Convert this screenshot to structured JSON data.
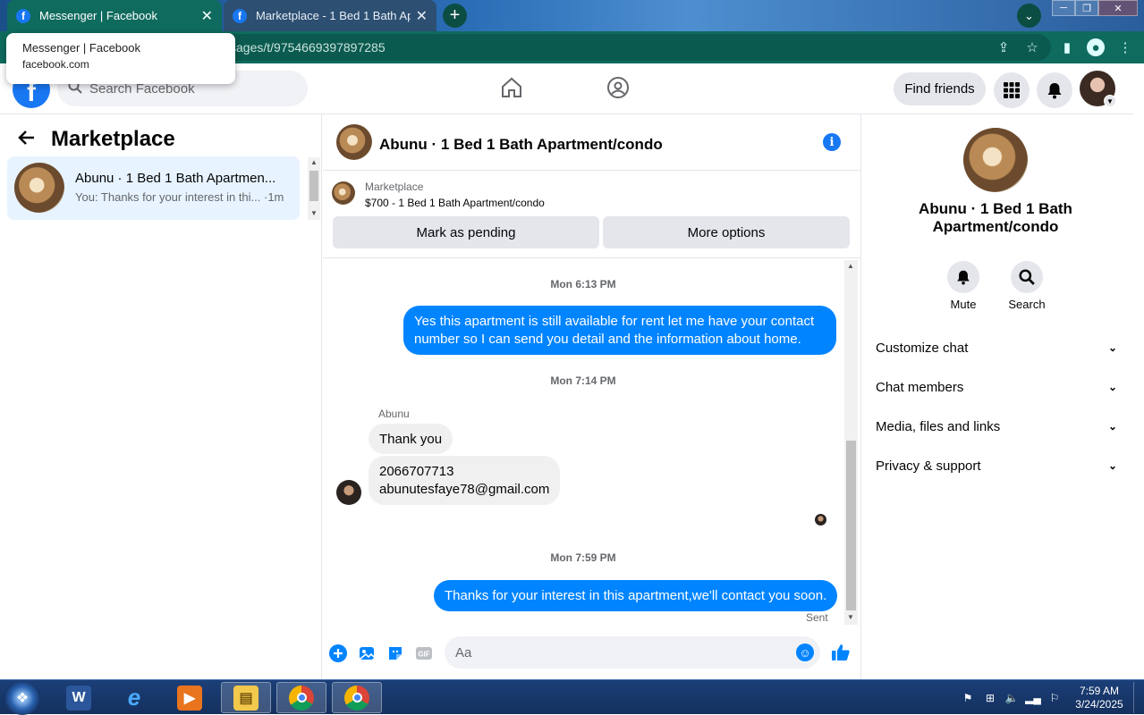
{
  "browser": {
    "tabs": [
      {
        "title": "Messenger | Facebook",
        "active": true
      },
      {
        "title": "Marketplace - 1 Bed 1 Bath Apartment/condo",
        "active": false
      }
    ],
    "url": "sages/t/9754669397897285",
    "tooltip": {
      "title": "Messenger | Facebook",
      "domain": "facebook.com"
    }
  },
  "fb_header": {
    "search_placeholder": "Search Facebook",
    "find_friends": "Find friends"
  },
  "left_panel": {
    "title": "Marketplace",
    "conversations": [
      {
        "name": "Abunu · 1 Bed 1 Bath Apartmen...",
        "snippet": "You: Thanks for your interest in thi... ·1m"
      }
    ]
  },
  "chat": {
    "title": "Abunu · 1 Bed 1 Bath Apartment/condo",
    "listing": {
      "source": "Marketplace",
      "price_title": "$700 - 1 Bed 1 Bath Apartment/condo",
      "btn_pending": "Mark as pending",
      "btn_more": "More options"
    },
    "messages": {
      "ts1": "Mon 6:13 PM",
      "m1": "Yes this apartment is still available for rent let me have your contact number so I can send you detail and the information about home.",
      "ts2": "Mon 7:14 PM",
      "sender": "Abunu",
      "m2": "Thank you",
      "m3_line1": "2066707713",
      "m3_line2": "abunutesfaye78@gmail.com",
      "ts3": "Mon 7:59 PM",
      "m4": "Thanks for your interest in this apartment,we'll contact you soon.",
      "status": "Sent"
    },
    "composer_placeholder": "Aa"
  },
  "right_panel": {
    "title": "Abunu · 1 Bed 1 Bath Apartment/condo",
    "actions": {
      "mute": "Mute",
      "search": "Search"
    },
    "sections": [
      "Customize chat",
      "Chat members",
      "Media, files and links",
      "Privacy & support"
    ]
  },
  "taskbar": {
    "time": "7:59 AM",
    "date": "3/24/2025"
  },
  "colors": {
    "fb_blue": "#1877f2",
    "messenger_blue": "#0084ff",
    "chrome_green": "#0f6b5e"
  }
}
